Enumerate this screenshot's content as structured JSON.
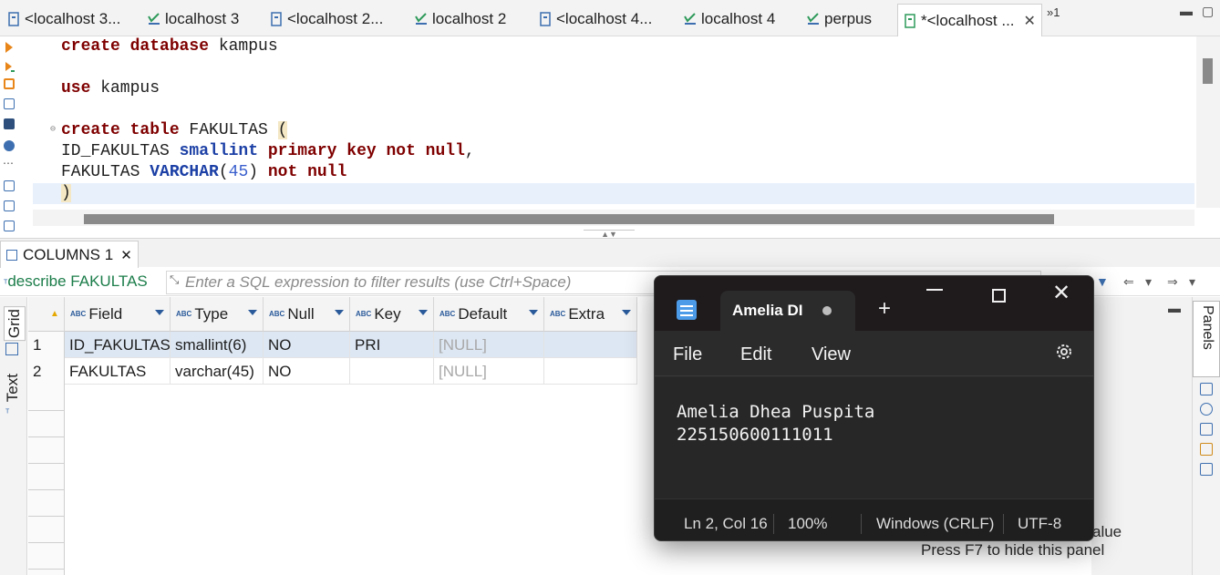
{
  "editor_tabs": [
    {
      "label": "<localhost 3...",
      "icon": "sql-editor-icon"
    },
    {
      "label": "localhost 3",
      "icon": "connection-icon"
    },
    {
      "label": "<localhost 2...",
      "icon": "sql-editor-icon"
    },
    {
      "label": "localhost 2",
      "icon": "connection-icon"
    },
    {
      "label": "<localhost 4...",
      "icon": "sql-editor-icon"
    },
    {
      "label": "localhost 4",
      "icon": "connection-icon"
    },
    {
      "label": "perpus",
      "icon": "connection-icon"
    },
    {
      "label": "*<localhost ...",
      "icon": "sql-editor-icon",
      "active": true
    }
  ],
  "tab_overflow": "»1",
  "sql": {
    "line1": {
      "kw": "create database",
      "rest": " kampus"
    },
    "line2": {
      "kw": "use",
      "rest": " kampus"
    },
    "line3": {
      "kw": "create table",
      "name": " FAKULTAS ",
      "paren": "("
    },
    "line4": {
      "a": "ID_FAKULTAS ",
      "ty": "smallint",
      "kw": " primary key not null",
      "rest": ","
    },
    "line5": {
      "a": "FAKULTAS ",
      "ty": "VARCHAR",
      "open": "(",
      "num": "45",
      "close": ") ",
      "kw": "not null"
    },
    "line6": {
      "paren": ")"
    }
  },
  "result": {
    "tab_label": "COLUMNS 1",
    "query": "describe FAKULTAS",
    "filter_placeholder": "Enter a SQL expression to filter results (use Ctrl+Space)",
    "side_tabs": [
      "Grid",
      "Text"
    ],
    "columns": [
      "Field",
      "Type",
      "Null",
      "Key",
      "Default",
      "Extra"
    ],
    "rows": [
      {
        "num": "1",
        "cells": [
          "ID_FAKULTAS",
          "smallint(6)",
          "NO",
          "PRI",
          "[NULL]",
          ""
        ]
      },
      {
        "num": "2",
        "cells": [
          "FAKULTAS",
          "varchar(45)",
          "NO",
          "",
          "[NULL]",
          ""
        ]
      }
    ],
    "panels_label": "Panels",
    "hint_value": "alue",
    "hint_panel": "Press F7 to hide this panel"
  },
  "notepad": {
    "tab_title": "Amelia DI",
    "menu": [
      "File",
      "Edit",
      "View"
    ],
    "content": [
      "Amelia Dhea Puspita",
      "225150600111011"
    ],
    "status": {
      "position": "Ln 2, Col 16",
      "zoom": "100%",
      "eol": "Windows (CRLF)",
      "encoding": "UTF-8"
    }
  },
  "colors": {
    "keyword": "#7f0000",
    "type": "#1b3fa5",
    "number": "#3a5fcd",
    "notepad_bg": "#2b2b2b",
    "notepad_accent": "#4c9be8"
  }
}
